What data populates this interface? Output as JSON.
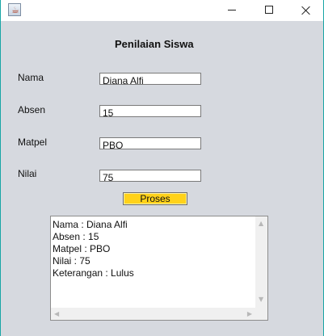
{
  "window": {
    "icon": "java-cup-icon",
    "controls": {
      "minimize": "minimize-icon",
      "maximize": "maximize-icon",
      "close": "close-icon"
    }
  },
  "form": {
    "title": "Penilaian Siswa",
    "fields": [
      {
        "label": "Nama",
        "value": "Diana Alfi"
      },
      {
        "label": "Absen",
        "value": "15"
      },
      {
        "label": "Matpel",
        "value": "PBO"
      },
      {
        "label": "Nilai",
        "value": "75"
      }
    ],
    "submit_label": "Proses",
    "submit_color": "#ffd21a"
  },
  "output": {
    "lines": [
      "Nama : Diana Alfi",
      "Absen : 15",
      "Matpel : PBO",
      "Nilai : 75",
      "Keterangan : Lulus"
    ]
  }
}
